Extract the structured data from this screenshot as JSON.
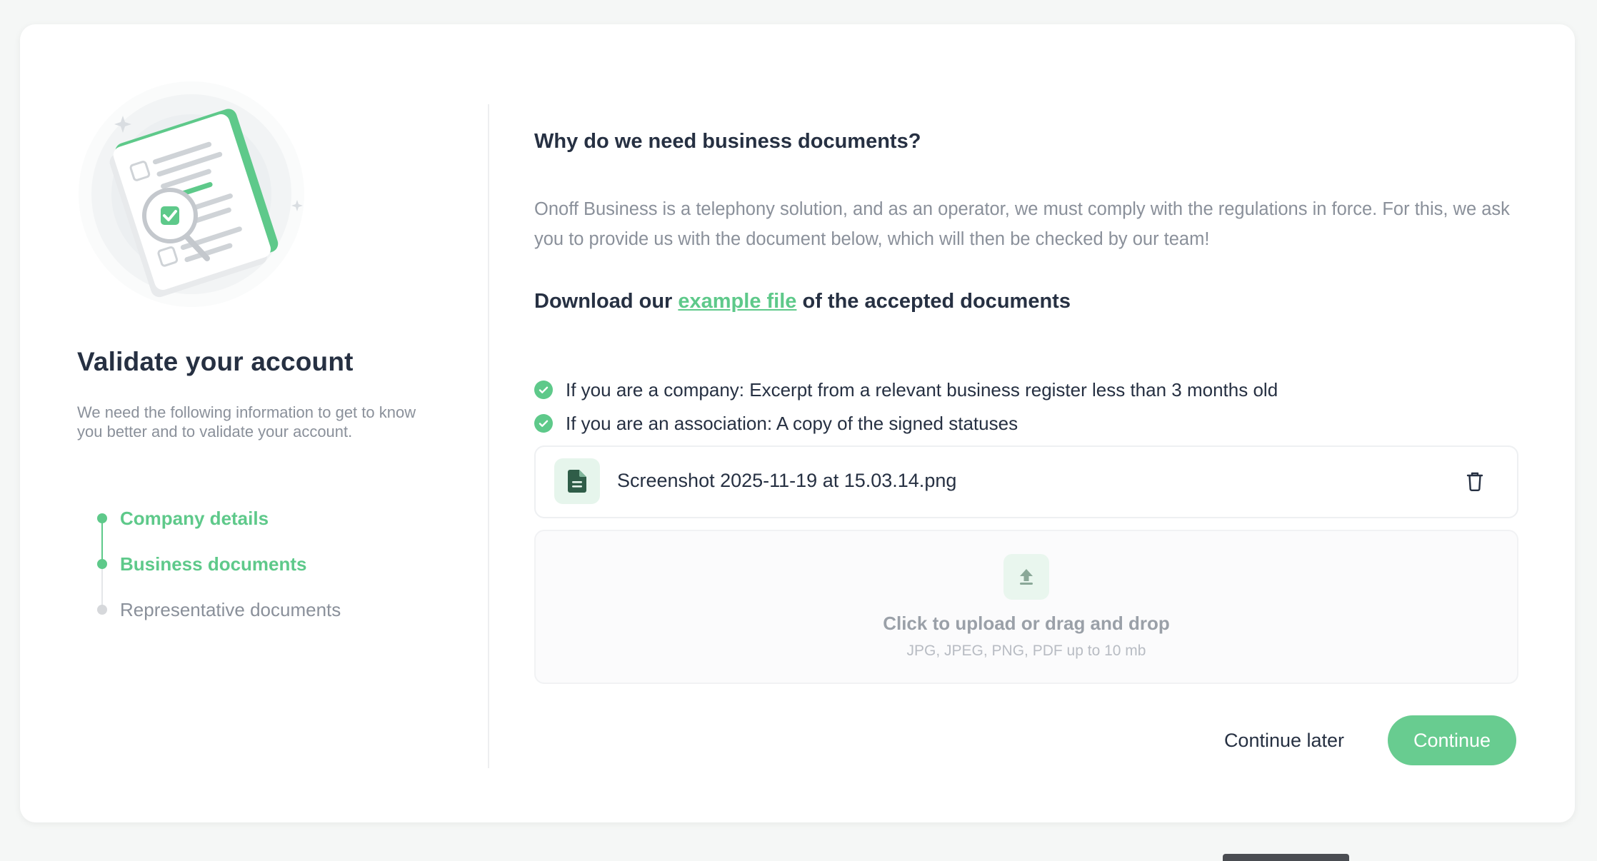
{
  "sidebar": {
    "title": "Validate your account",
    "description": "We need the following information to get to know you better and to validate your account.",
    "steps": [
      {
        "label": "Company details",
        "status": "done"
      },
      {
        "label": "Business documents",
        "status": "done"
      },
      {
        "label": "Representative documents",
        "status": "todo"
      }
    ]
  },
  "main": {
    "title": "Why do we need business documents?",
    "description": "Onoff Business is a telephony solution, and as an operator, we must comply with the regulations in force. For this, we ask you to provide us with the document below, which will then be checked by our team!",
    "download": {
      "prefix": "Download our",
      "link_text": "example file",
      "suffix": "of the accepted documents"
    },
    "requirements": [
      "If you are a company: Excerpt from a relevant business register less than 3 months old",
      "If you are an association: A copy of the signed statuses"
    ],
    "uploaded_file": {
      "name": "Screenshot 2025-11-19 at 15.03.14.png",
      "icon": "document-icon"
    },
    "dropzone": {
      "title": "Click to upload or drag and drop",
      "hint": "JPG, JPEG, PNG, PDF up to 10 mb",
      "icon": "upload-icon"
    },
    "actions": {
      "later_label": "Continue later",
      "continue_label": "Continue"
    }
  },
  "colors": {
    "accent": "#5ec98a",
    "button": "#68cc90",
    "heading": "#263042",
    "muted": "#8a909a",
    "background": "#f5f7f6"
  }
}
